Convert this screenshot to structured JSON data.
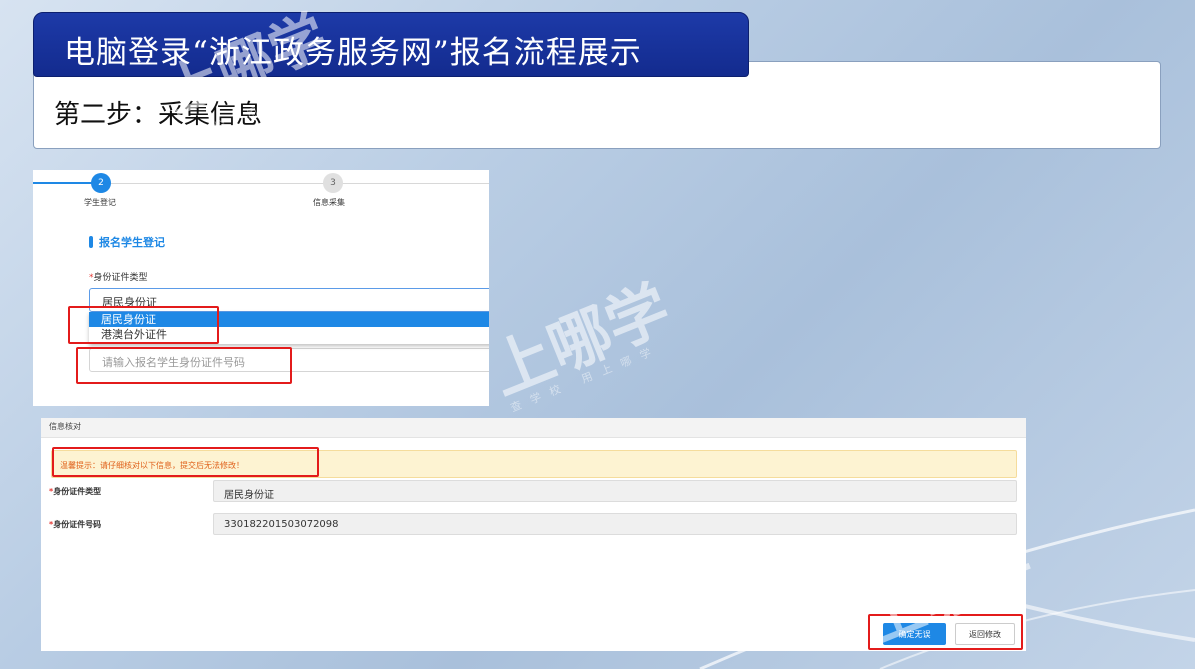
{
  "slide": {
    "title": "电脑登录“浙江政务服务网”报名流程展示",
    "subtitle": "第二步：采集信息"
  },
  "form_panel": {
    "steps": [
      {
        "number": "2",
        "label": "学生登记",
        "active": true
      },
      {
        "number": "3",
        "label": "信息采集",
        "active": false
      }
    ],
    "section_title": "报名学生登记",
    "id_type_label": "身份证件类型",
    "required_mark": "*",
    "id_type_selected": "居民身份证",
    "id_type_options": [
      "居民身份证",
      "港澳台外证件"
    ],
    "id_number_placeholder": "请输入报名学生身份证件号码"
  },
  "verify_panel": {
    "header": "信息核对",
    "notice": "温馨提示：请仔细核对以下信息，提交后无法修改！",
    "required_mark": "*",
    "rows": [
      {
        "label": "身份证件类型",
        "value": "居民身份证"
      },
      {
        "label": "身份证件号码",
        "value": "330182201503072098"
      }
    ],
    "confirm_button": "确定无误",
    "back_button": "返回修改"
  },
  "watermark": {
    "brand": "上哪学",
    "slogan": "查学校  用上哪学"
  },
  "colors": {
    "banner": "#1d3aa8",
    "accent_blue": "#1e88e5",
    "highlight_red": "#e31b1b",
    "notice_bg": "#fdf3d2",
    "notice_text": "#e0601a"
  }
}
